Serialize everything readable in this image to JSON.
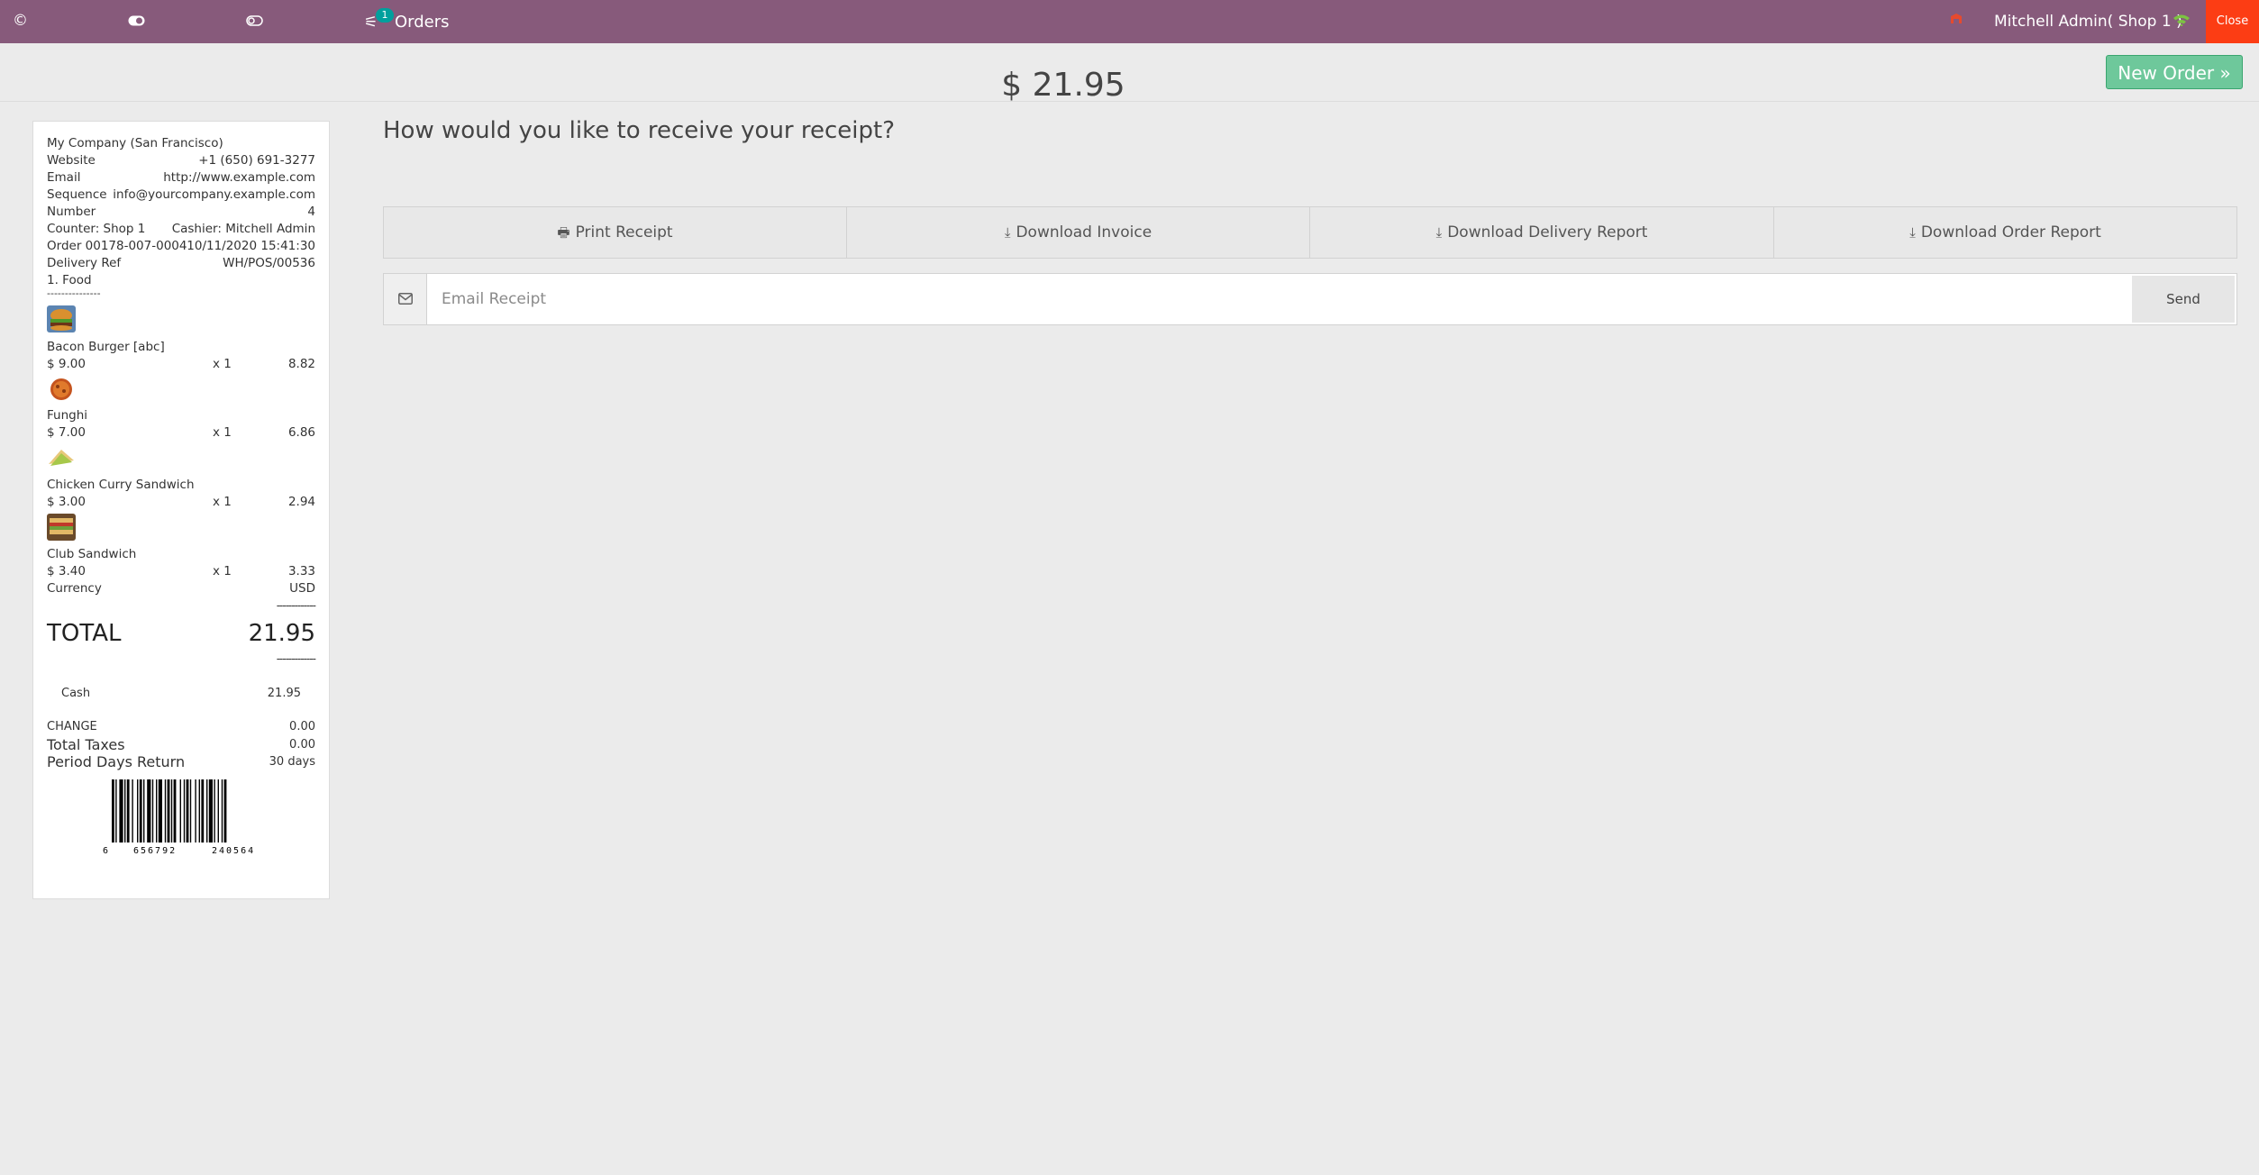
{
  "topbar": {
    "icons": [
      "circle-info-icon",
      "toggle-icon",
      "toggle-outline-icon"
    ],
    "orders_badge": "1",
    "orders_label": "Orders",
    "user": "Mitchell Admin( Shop 1 )",
    "close_label": "Close"
  },
  "header": {
    "amount": "$ 21.95",
    "new_order_label": "New Order »"
  },
  "receipt": {
    "company": "My Company (San Francisco)",
    "website_label": "Website",
    "website_value": "+1 (650) 691-3277",
    "email_label": "Email",
    "email_value": "http://www.example.com",
    "sequence_label": "Sequence",
    "sequence_value": "info@yourcompany.example.com",
    "number_label": "Number",
    "number_value": "4",
    "counter": "Counter: Shop 1",
    "cashier": "Cashier: Mitchell Admin",
    "order": "Order 00178-007-0004",
    "order_date": "10/11/2020 15:41:30",
    "delivery_label": "Delivery Ref",
    "delivery_value": "WH/POS/00536",
    "category": "1. Food",
    "separator": "---------------",
    "items": [
      {
        "name": "Bacon Burger [abc]",
        "price": "$ 9.00",
        "qty": "x 1",
        "total": "8.82"
      },
      {
        "name": "Funghi",
        "price": "$ 7.00",
        "qty": "x 1",
        "total": "6.86"
      },
      {
        "name": "Chicken Curry Sandwich",
        "price": "$ 3.00",
        "qty": "x 1",
        "total": "2.94"
      },
      {
        "name": "Club Sandwich",
        "price": "$ 3.40",
        "qty": "x 1",
        "total": "3.33"
      }
    ],
    "currency_label": "Currency",
    "currency_value": "USD",
    "dashes": "-------------",
    "total_label": "TOTAL",
    "total_value": "21.95",
    "payment_label": "Cash",
    "payment_value": "21.95",
    "change_label": "CHANGE",
    "change_value": "0.00",
    "taxes_label": "Total Taxes",
    "taxes_value": "0.00",
    "return_label": "Period Days Return",
    "return_value": "30 days",
    "barcode": {
      "first": "6",
      "left": "656792",
      "right": "240564"
    }
  },
  "main": {
    "question": "How would you like to receive your receipt?",
    "buttons": [
      {
        "icon": "printer-icon",
        "label": "Print Receipt"
      },
      {
        "icon": "download-icon",
        "label": "Download Invoice"
      },
      {
        "icon": "download-icon",
        "label": "Download Delivery Report"
      },
      {
        "icon": "download-icon",
        "label": "Download Order Report"
      }
    ],
    "email_placeholder": "Email Receipt",
    "send_label": "Send"
  },
  "colors": {
    "topbar": "#875a7b",
    "close": "#fc3d14",
    "new_order": "#6ec89b",
    "badge": "#00a09d"
  }
}
